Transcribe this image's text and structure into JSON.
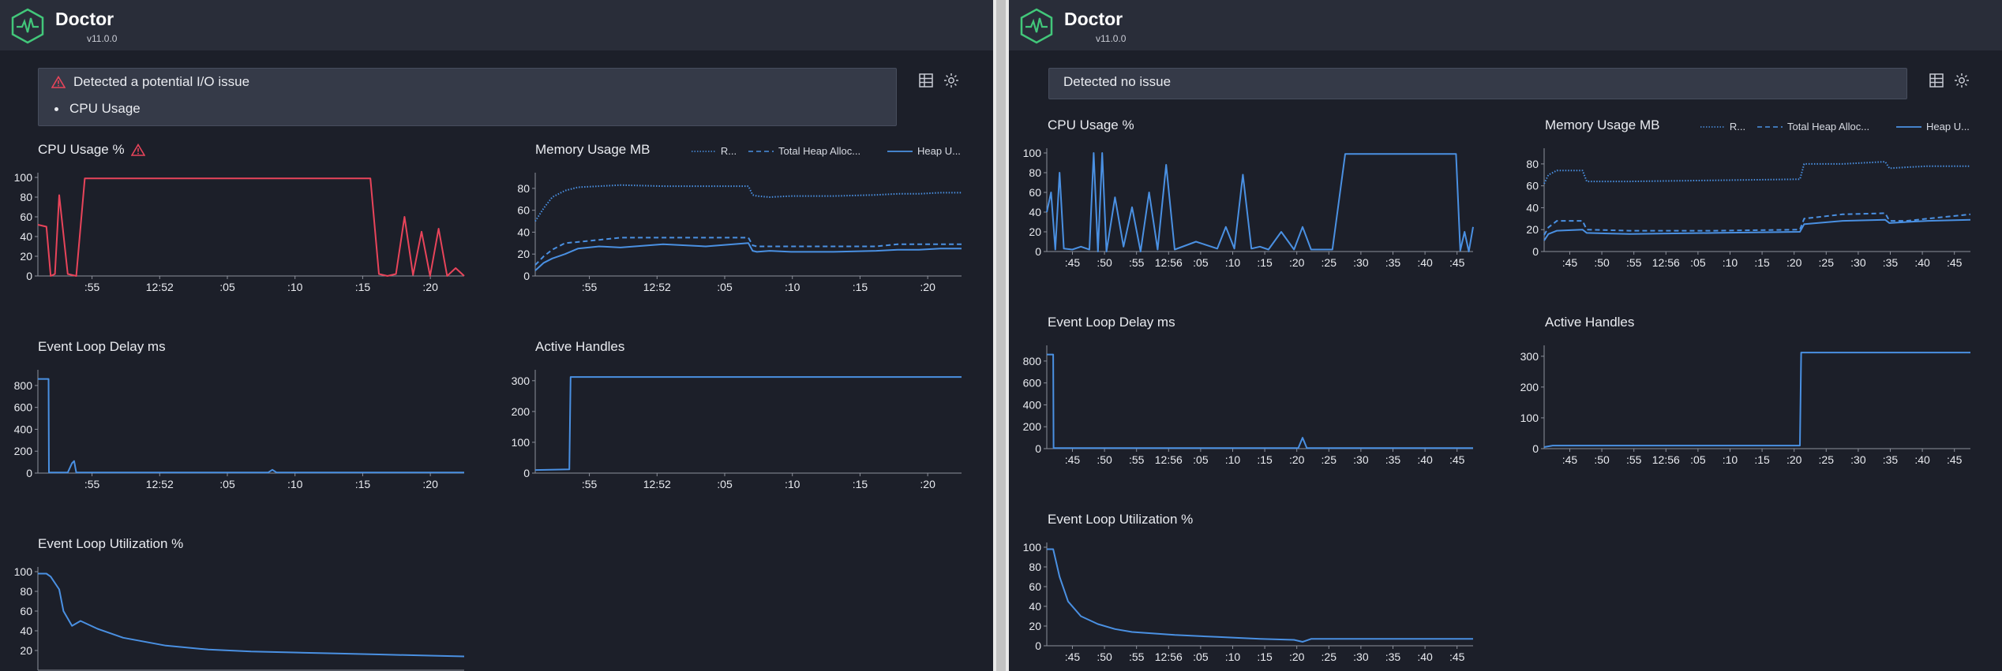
{
  "app": {
    "name": "Doctor",
    "version": "v11.0.0"
  },
  "icons": {
    "logo": "heartbeat-hexagon-icon",
    "warning": "warning-triangle-icon",
    "layout": "grid-layout-icon",
    "theme": "sun-theme-icon"
  },
  "colors": {
    "background": "#1c1f29",
    "header": "#292d39",
    "panel": "#353a48",
    "series_blue": "#4a90e2",
    "warning_red": "#e8445a",
    "logo_green": "#42c77a"
  },
  "left": {
    "alert": {
      "title": "Detected a potential I/O issue",
      "items": [
        "CPU Usage"
      ]
    },
    "charts": {
      "cpu": {
        "title": "CPU Usage %",
        "warning": true
      },
      "memory": {
        "title": "Memory Usage MB",
        "legend": [
          "R...",
          "Total Heap Alloc...",
          "Heap U..."
        ]
      },
      "delay": {
        "title": "Event Loop Delay ms"
      },
      "handles": {
        "title": "Active Handles"
      },
      "elu": {
        "title": "Event Loop Utilization %"
      }
    }
  },
  "right": {
    "alert": {
      "title": "Detected no issue",
      "items": []
    },
    "charts": {
      "cpu": {
        "title": "CPU Usage %",
        "warning": false
      },
      "memory": {
        "title": "Memory Usage MB",
        "legend": [
          "R...",
          "Total Heap Alloc...",
          "Heap U..."
        ]
      },
      "delay": {
        "title": "Event Loop Delay ms"
      },
      "handles": {
        "title": "Active Handles"
      },
      "elu": {
        "title": "Event Loop Utilization %"
      }
    }
  },
  "chart_data": [
    {
      "id": "left-cpu",
      "type": "line",
      "title": "CPU Usage %",
      "ylim": [
        0,
        100
      ],
      "yticks": [
        0,
        20,
        40,
        60,
        80,
        100
      ],
      "xticks": [
        ":55",
        "12:52",
        ":05",
        ":10",
        ":15",
        ":20"
      ],
      "color": "#e8445a",
      "x": [
        0,
        2,
        3,
        4,
        5,
        7,
        9,
        11,
        14,
        18,
        22,
        26,
        30,
        34,
        38,
        42,
        46,
        50,
        54,
        58,
        62,
        66,
        70,
        74,
        78,
        80,
        82,
        84,
        86,
        88,
        90,
        92,
        94,
        96,
        98,
        100
      ],
      "series": [
        {
          "name": "CPU",
          "values": [
            52,
            50,
            0,
            2,
            82,
            2,
            0,
            99,
            99,
            99,
            99,
            99,
            99,
            99,
            99,
            99,
            99,
            99,
            99,
            99,
            99,
            99,
            99,
            99,
            99,
            2,
            0,
            2,
            60,
            1,
            45,
            0,
            48,
            0,
            8,
            0
          ]
        }
      ]
    },
    {
      "id": "left-memory",
      "type": "line",
      "title": "Memory Usage MB",
      "ylim": [
        0,
        90
      ],
      "yticks": [
        0,
        20,
        40,
        60,
        80
      ],
      "xticks": [
        ":55",
        "12:52",
        ":05",
        ":10",
        ":15",
        ":20"
      ],
      "x": [
        0,
        2,
        4,
        7,
        10,
        15,
        20,
        30,
        40,
        50,
        51,
        52,
        55,
        60,
        70,
        80,
        85,
        90,
        95,
        100
      ],
      "series": [
        {
          "name": "RSS",
          "style": "dotted",
          "values": [
            50,
            62,
            72,
            78,
            81,
            82,
            83,
            82,
            82,
            82,
            74,
            73,
            72,
            73,
            73,
            74,
            75,
            75,
            76,
            76
          ]
        },
        {
          "name": "Total Heap Allocated",
          "style": "dashed",
          "values": [
            10,
            18,
            24,
            30,
            31,
            33,
            35,
            35,
            35,
            35,
            28,
            27,
            27,
            27,
            27,
            27,
            29,
            29,
            29,
            29
          ]
        },
        {
          "name": "Heap Used",
          "style": "solid",
          "values": [
            5,
            12,
            16,
            20,
            25,
            27,
            26,
            29,
            27,
            30,
            23,
            22,
            23,
            22,
            22,
            23,
            24,
            24,
            25,
            25
          ]
        }
      ]
    },
    {
      "id": "left-delay",
      "type": "line",
      "title": "Event Loop Delay ms",
      "ylim": [
        0,
        900
      ],
      "yticks": [
        0,
        200,
        400,
        600,
        800
      ],
      "xticks": [
        ":55",
        "12:52",
        ":05",
        ":10",
        ":15",
        ":20"
      ],
      "color": "#4a90e2",
      "x": [
        0,
        2.5,
        2.6,
        7,
        8,
        8.5,
        9,
        10,
        30,
        40,
        54,
        55,
        56,
        80,
        100
      ],
      "series": [
        {
          "name": "Delay",
          "values": [
            860,
            860,
            5,
            5,
            90,
            110,
            5,
            5,
            5,
            5,
            5,
            30,
            5,
            5,
            5
          ]
        }
      ]
    },
    {
      "id": "left-handles",
      "type": "line",
      "title": "Active Handles",
      "ylim": [
        0,
        320
      ],
      "yticks": [
        0,
        100,
        200,
        300
      ],
      "xticks": [
        ":55",
        "12:52",
        ":05",
        ":10",
        ":15",
        ":20"
      ],
      "color": "#4a90e2",
      "x": [
        0,
        8,
        8.3,
        100
      ],
      "series": [
        {
          "name": "Handles",
          "values": [
            10,
            12,
            312,
            312
          ]
        }
      ]
    },
    {
      "id": "left-elu",
      "type": "line",
      "title": "Event Loop Utilization %",
      "ylim": [
        0,
        100
      ],
      "yticks": [
        20,
        40,
        60,
        80,
        100
      ],
      "color": "#4a90e2",
      "x": [
        0,
        2,
        3,
        5,
        6,
        8,
        10,
        14,
        20,
        30,
        40,
        50,
        60,
        70,
        80,
        90,
        100
      ],
      "series": [
        {
          "name": "ELU",
          "values": [
            98,
            98,
            95,
            82,
            60,
            45,
            50,
            42,
            33,
            25,
            21,
            19,
            18,
            17,
            16,
            15,
            14
          ]
        }
      ]
    },
    {
      "id": "right-cpu",
      "type": "line",
      "title": "CPU Usage %",
      "ylim": [
        0,
        100
      ],
      "yticks": [
        0,
        20,
        40,
        60,
        80,
        100
      ],
      "xticks": [
        ":45",
        ":50",
        ":55",
        "12:56",
        ":05",
        ":10",
        ":15",
        ":20",
        ":25",
        ":30",
        ":35",
        ":40",
        ":45"
      ],
      "color": "#4a90e2",
      "x": [
        0,
        1,
        2,
        3,
        4,
        6,
        8,
        10,
        11,
        12,
        13,
        14,
        16,
        18,
        20,
        22,
        24,
        26,
        28,
        30,
        35,
        40,
        42,
        44,
        46,
        48,
        50,
        52,
        55,
        58,
        60,
        62,
        67,
        70,
        80,
        90,
        95,
        96,
        97,
        98,
        99,
        100
      ],
      "series": [
        {
          "name": "CPU",
          "values": [
            40,
            60,
            2,
            80,
            3,
            2,
            5,
            2,
            100,
            0,
            100,
            0,
            55,
            5,
            45,
            0,
            60,
            2,
            88,
            2,
            10,
            3,
            25,
            3,
            78,
            3,
            5,
            2,
            20,
            2,
            25,
            2,
            2,
            99,
            99,
            99,
            99,
            99,
            1,
            20,
            0,
            25
          ]
        }
      ]
    },
    {
      "id": "right-memory",
      "type": "line",
      "title": "Memory Usage MB",
      "ylim": [
        0,
        90
      ],
      "yticks": [
        0,
        20,
        40,
        60,
        80
      ],
      "xticks": [
        ":45",
        ":50",
        ":55",
        "12:56",
        ":05",
        ":10",
        ":15",
        ":20",
        ":25",
        ":30",
        ":35",
        ":40",
        ":45"
      ],
      "x": [
        0,
        1,
        3,
        9,
        10,
        20,
        40,
        60,
        61,
        70,
        80,
        81,
        85,
        90,
        100
      ],
      "series": [
        {
          "name": "RSS",
          "style": "dotted",
          "values": [
            62,
            70,
            74,
            74,
            64,
            64,
            65,
            66,
            80,
            80,
            82,
            76,
            77,
            78,
            78
          ]
        },
        {
          "name": "Total Heap Allocated",
          "style": "dashed",
          "values": [
            15,
            22,
            28,
            28,
            20,
            19,
            19,
            20,
            30,
            34,
            35,
            28,
            28,
            30,
            34
          ]
        },
        {
          "name": "Heap Used",
          "style": "solid",
          "values": [
            10,
            16,
            19,
            20,
            17,
            16,
            17,
            18,
            25,
            28,
            29,
            26,
            27,
            28,
            29
          ]
        }
      ]
    },
    {
      "id": "right-delay",
      "type": "line",
      "title": "Event Loop Delay ms",
      "ylim": [
        0,
        900
      ],
      "yticks": [
        0,
        200,
        400,
        600,
        800
      ],
      "xticks": [
        ":45",
        ":50",
        ":55",
        "12:56",
        ":05",
        ":10",
        ":15",
        ":20",
        ":25",
        ":30",
        ":35",
        ":40",
        ":45"
      ],
      "color": "#4a90e2",
      "x": [
        0,
        1.5,
        1.6,
        20,
        40,
        59,
        60,
        61,
        80,
        100
      ],
      "series": [
        {
          "name": "Delay",
          "values": [
            860,
            860,
            5,
            5,
            5,
            5,
            100,
            5,
            5,
            5
          ]
        }
      ]
    },
    {
      "id": "right-handles",
      "type": "line",
      "title": "Active Handles",
      "ylim": [
        0,
        320
      ],
      "yticks": [
        0,
        100,
        200,
        300
      ],
      "xticks": [
        ":45",
        ":50",
        ":55",
        "12:56",
        ":05",
        ":10",
        ":15",
        ":20",
        ":25",
        ":30",
        ":35",
        ":40",
        ":45"
      ],
      "color": "#4a90e2",
      "x": [
        0,
        2,
        60,
        60.3,
        100
      ],
      "series": [
        {
          "name": "Handles",
          "values": [
            5,
            10,
            10,
            312,
            312
          ]
        }
      ]
    },
    {
      "id": "right-elu",
      "type": "line",
      "title": "Event Loop Utilization %",
      "ylim": [
        0,
        100
      ],
      "yticks": [
        0,
        20,
        40,
        60,
        80,
        100
      ],
      "xticks": [
        ":45",
        ":50",
        ":55",
        "12:56",
        ":05",
        ":10",
        ":15",
        ":20",
        ":25",
        ":30",
        ":35",
        ":40",
        ":45"
      ],
      "color": "#4a90e2",
      "x": [
        0,
        1.5,
        3,
        5,
        8,
        12,
        16,
        20,
        30,
        40,
        50,
        58,
        60,
        62,
        70,
        80,
        90,
        100
      ],
      "series": [
        {
          "name": "ELU",
          "values": [
            98,
            98,
            70,
            45,
            30,
            22,
            17,
            14,
            11,
            9,
            7,
            6,
            4,
            7,
            7,
            7,
            7,
            7
          ]
        }
      ]
    }
  ]
}
